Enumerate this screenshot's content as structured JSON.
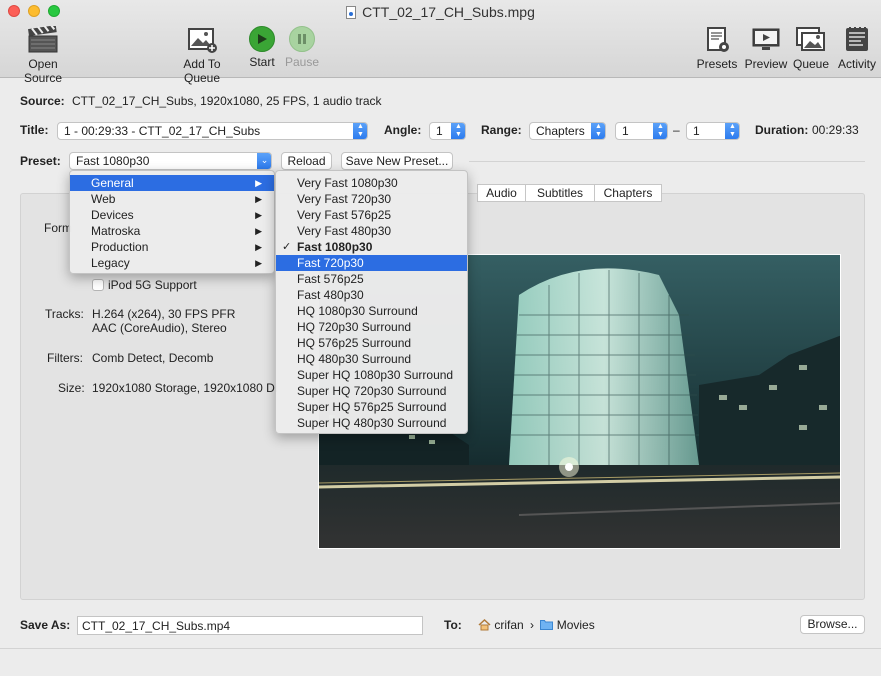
{
  "window": {
    "title": "CTT_02_17_CH_Subs.mpg"
  },
  "toolbar": {
    "open_source": "Open Source",
    "add_to_queue": "Add To Queue",
    "start": "Start",
    "pause": "Pause",
    "presets": "Presets",
    "preview": "Preview",
    "queue": "Queue",
    "activity": "Activity"
  },
  "source": {
    "label": "Source:",
    "value": "CTT_02_17_CH_Subs, 1920x1080, 25 FPS, 1 audio track"
  },
  "title_row": {
    "title_label": "Title:",
    "title_value": "1 - 00:29:33 - CTT_02_17_CH_Subs",
    "angle_label": "Angle:",
    "angle_value": "1",
    "range_label": "Range:",
    "range_value": "Chapters",
    "range_start": "1",
    "range_dash": "–",
    "range_end": "1",
    "duration_label": "Duration:",
    "duration_value": "00:29:33"
  },
  "preset_row": {
    "label": "Preset:",
    "value": "Fast 1080p30",
    "reload": "Reload",
    "save_new": "Save New Preset..."
  },
  "tabs": [
    "Audio",
    "Subtitles",
    "Chapters"
  ],
  "summary": {
    "format_label": "Form",
    "ipod_label": "iPod 5G Support",
    "tracks_label": "Tracks:",
    "tracks_line1": "H.264 (x264), 30 FPS PFR",
    "tracks_line2": "AAC (CoreAudio), Stereo",
    "filters_label": "Filters:",
    "filters_value": "Comb Detect, Decomb",
    "size_label": "Size:",
    "size_value": "1920x1080 Storage, 1920x1080 Dis"
  },
  "category_menu": {
    "items": [
      "General",
      "Web",
      "Devices",
      "Matroska",
      "Production",
      "Legacy"
    ],
    "highlighted": "General"
  },
  "preset_menu": {
    "items": [
      "Very Fast 1080p30",
      "Very Fast 720p30",
      "Very Fast 576p25",
      "Very Fast 480p30",
      "Fast 1080p30",
      "Fast 720p30",
      "Fast 576p25",
      "Fast 480p30",
      "HQ 1080p30 Surround",
      "HQ 720p30 Surround",
      "HQ 576p25 Surround",
      "HQ 480p30 Surround",
      "Super HQ 1080p30 Surround",
      "Super HQ 720p30 Surround",
      "Super HQ 576p25 Surround",
      "Super HQ 480p30 Surround"
    ],
    "checked": "Fast 1080p30",
    "highlighted": "Fast 720p30"
  },
  "save_row": {
    "label": "Save As:",
    "filename": "CTT_02_17_CH_Subs.mp4",
    "to_label": "To:",
    "path_home": "crifan",
    "path_sep": "›",
    "path_folder": "Movies",
    "browse": "Browse..."
  },
  "colors": {
    "accent": "#2c6de2",
    "start_green": "#3aa535",
    "pause_disabled": "#a8d3a0"
  },
  "icons": {
    "open_source": "clapperboard-icon",
    "add_to_queue": "photo-add-icon",
    "start": "play-icon",
    "pause": "pause-icon",
    "presets": "document-gear-icon",
    "preview": "monitor-play-icon",
    "queue": "photo-stack-icon",
    "activity": "log-icon",
    "home": "home-icon",
    "folder": "folder-icon"
  }
}
